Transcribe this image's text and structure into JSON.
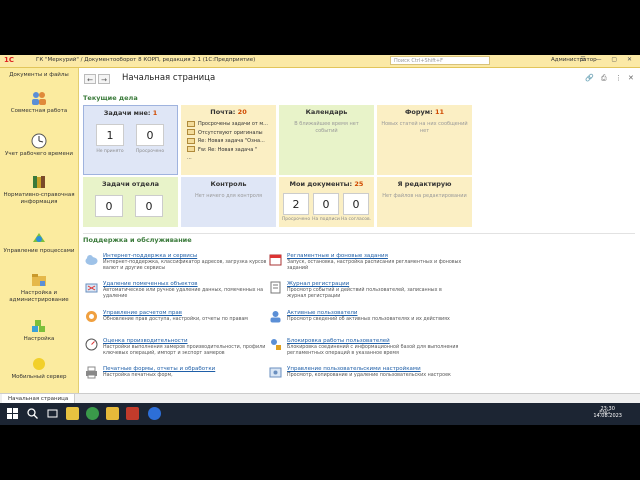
{
  "titlebar": {
    "logo": "1С",
    "title": "ГК \"Меркурий\" / Документооборот 8 КОРП, редакция 2.1  (1С:Предприятие)",
    "search_placeholder": "Поиск Ctrl+Shift+F",
    "user": "Администратор"
  },
  "sidebar": {
    "items": [
      {
        "label": "Документы и файлы"
      },
      {
        "label": "Совместная работа"
      },
      {
        "label": "Учет рабочего времени"
      },
      {
        "label": "Нормативно-справочная информация"
      },
      {
        "label": "Управление процессами"
      },
      {
        "label": "Настройка и администрирование"
      },
      {
        "label": "Настройка"
      },
      {
        "label": "Мобильный сервер"
      }
    ]
  },
  "page": {
    "title": "Начальная страница",
    "current_section": "Текущие дела",
    "support_section": "Поддержка и обслуживание"
  },
  "tiles": {
    "tasks_me": {
      "title": "Задачи мне: ",
      "count": "1",
      "num1": "1",
      "num2": "0",
      "lbl1": "Не принято",
      "lbl2": "Просрочено"
    },
    "mail": {
      "title": "Почта: ",
      "count": "20",
      "items": [
        "Просрочены задачи от м...",
        "Отсутствуют оригиналы",
        "Re: Новая задача \"Озна...",
        "Fw: Re: Новая задача \""
      ],
      "more": "..."
    },
    "calendar": {
      "title": "Календарь",
      "empty": "В ближайшее время нет событий"
    },
    "forum": {
      "title": "Форум: ",
      "count": "11",
      "empty": "Новых статей на них сообщений нет"
    },
    "tasks_dept": {
      "title": "Задачи отдела",
      "num1": "0",
      "num2": "0"
    },
    "control": {
      "title": "Контроль",
      "empty": "Нет ничего для контроля"
    },
    "my_docs": {
      "title": "Мои документы: ",
      "count": "25",
      "num1": "2",
      "num2": "0",
      "num3": "0",
      "lbl1": "Просрочено",
      "lbl2": "На подписи",
      "lbl3": "На согласов."
    },
    "editing": {
      "title": "Я редактирую",
      "empty": "Нет файлов на редактировании"
    }
  },
  "support": {
    "left": [
      {
        "title": "Интернет-поддержка и сервисы",
        "desc": "Интернет-поддержка, классификатор адресов, загрузка курсов валют и другие сервисы"
      },
      {
        "title": "Удаление помеченных объектов",
        "desc": "Автоматическое или ручное удаление данных, помеченных на удаление"
      },
      {
        "title": "Управление расчетом прав",
        "desc": "Обновление прав доступа, настройки, отчеты по правам"
      },
      {
        "title": "Оценка производительности",
        "desc": "Настройки выполнения замеров производительности, профили ключевых операций, импорт и экспорт замеров"
      },
      {
        "title": "Печатные формы, отчеты и обработки",
        "desc": "Настройка печатных форм,"
      }
    ],
    "right": [
      {
        "title": "Регламентные и фоновые задания",
        "desc": "Запуск, остановка, настройка расписания регламентных и фоновых заданий"
      },
      {
        "title": "Журнал регистрации",
        "desc": "Просмотр событий и действий пользователей, записанных в журнал регистрации"
      },
      {
        "title": "Активные пользователи",
        "desc": "Просмотр сведений об активных пользователях и их действиях"
      },
      {
        "title": "Блокировка работы пользователей",
        "desc": "Блокировка соединений с информационной базой для выполнения регламентных операций в указанное время"
      },
      {
        "title": "Управление пользовательскими настройками",
        "desc": "Просмотр, копирование и удаление пользовательских настроек"
      }
    ]
  },
  "tabbar": {
    "tab": "Начальная страница"
  },
  "taskbar": {
    "tray": "ENG",
    "time": "23:30",
    "date": "14.08.2023"
  },
  "colors": {
    "accent": "#3a7a3a",
    "count": "#d04a00",
    "link": "#1f5fa8",
    "sidebar": "#fbeb9f"
  }
}
